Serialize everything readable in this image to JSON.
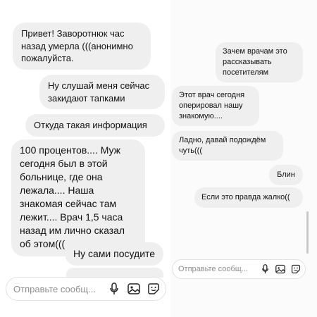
{
  "left_chat": {
    "messages": [
      {
        "side": "left",
        "text": "Привет! Заворотнюк час назад умерла (((анонимно пожалуйста."
      },
      {
        "side": "right",
        "text": "Ну слушай меня сейчас закидают тапками"
      },
      {
        "side": "left",
        "text": "Откуда такая информация"
      },
      {
        "side": "left",
        "text": "100 процентов.... Муж сегодня был в этой больнице, где она лежала.... Наша знакомая сейчас там лежит.... Врач 1,5 часа назад им лично сказал об этом((("
      },
      {
        "side": "right",
        "text": "Ну сами посудите"
      }
    ],
    "composer": {
      "placeholder": "Отправьте сообщ..."
    }
  },
  "right_chat": {
    "messages": [
      {
        "side": "right",
        "text": "Зачем врачам это рассказывать посетителям"
      },
      {
        "side": "left",
        "text": "Этот врач сегодня оперировал нашу знакомую...."
      },
      {
        "side": "left",
        "text": "Ладно, давай подождём чуть((("
      },
      {
        "side": "right",
        "text": "Блин"
      },
      {
        "side": "right",
        "text": "Если это правда жалко(("
      }
    ],
    "composer": {
      "placeholder": "Отправьте сообщ..."
    }
  },
  "icons": [
    "mic-icon",
    "image-icon",
    "sticker-icon"
  ],
  "colors": {
    "bubble": "#efefef",
    "placeholder": "#8e8e8e",
    "background": "#ffffff"
  }
}
